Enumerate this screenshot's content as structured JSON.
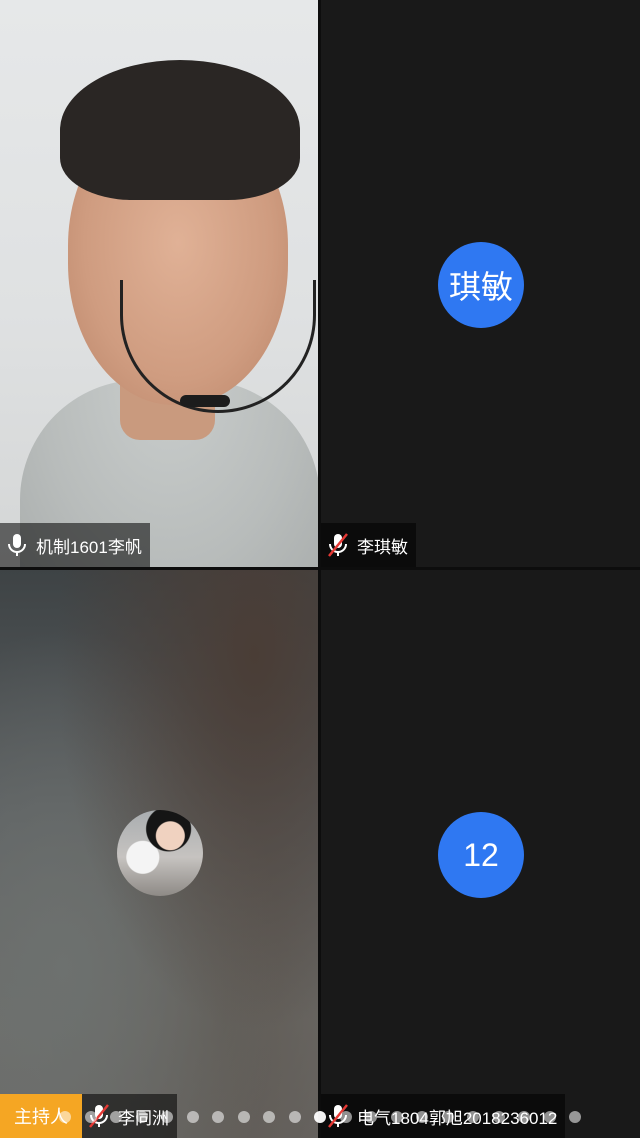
{
  "participants": [
    {
      "name": "机制1601李帆",
      "mic": "on",
      "video": "on"
    },
    {
      "name": "李琪敏",
      "mic": "muted",
      "avatar_text": "琪敏",
      "avatar_color": "#2f78f2"
    },
    {
      "name": "李同洲",
      "mic": "muted",
      "role_badge": "主持人",
      "badge_color": "#f5a623",
      "avatar": "profile-photo"
    },
    {
      "name": "电气1804郭旭2018236012",
      "mic": "muted",
      "avatar_text": "12",
      "avatar_color": "#2f78f2"
    }
  ],
  "pagination": {
    "total_pages": 21,
    "current_page": 11
  }
}
